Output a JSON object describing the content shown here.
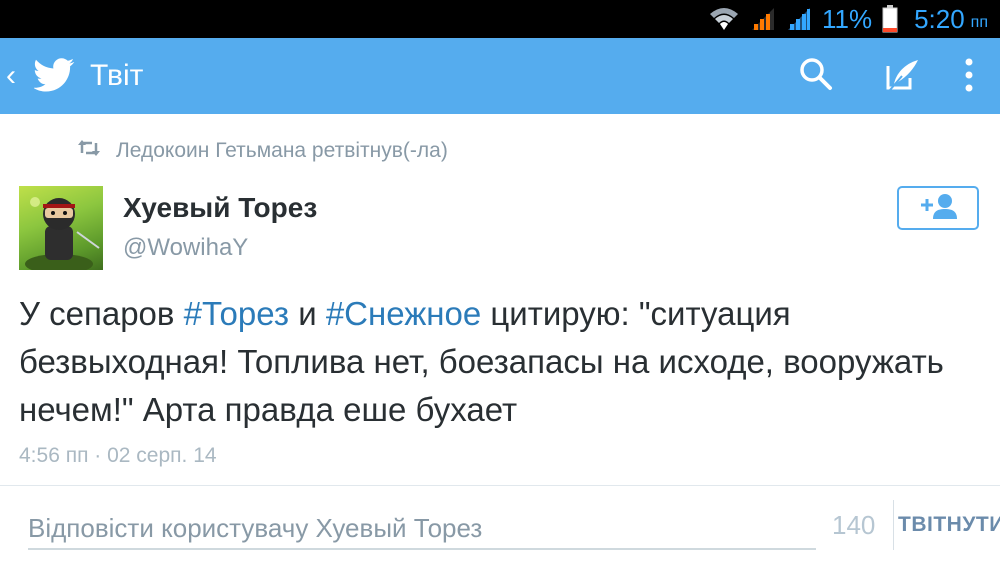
{
  "status_bar": {
    "battery_percent_label": "11%",
    "time": "5:20",
    "ampm": "пп",
    "battery_level": 0.11,
    "icons": [
      "wifi-icon",
      "signal-icon",
      "signal-icon",
      "battery-icon"
    ],
    "accent_color": "#33a7ff"
  },
  "action_bar": {
    "title": "Твіт",
    "background_color": "#55acee",
    "icons": [
      "back-chevron-icon",
      "twitter-bird-icon",
      "search-icon",
      "compose-tweet-icon",
      "overflow-menu-icon"
    ]
  },
  "tweet": {
    "retweet_notice": "Ледокоин Гетьмана ретвітнув(-ла)",
    "author_name": "Хуевый Торез",
    "author_handle": "@WowihaY",
    "text_part1": "У сепаров ",
    "hashtag1": "#Торез",
    "text_part2": " и ",
    "hashtag2": "#Снежное",
    "text_part3": " цитирую: \"ситуация безвыходная! Топлива нет, боезапасы на исходе, вооружать нечем!\" Арта правда еше бухает",
    "timestamp": "4:56 пп · 02 серп. 14",
    "hashtag_color": "#2b7bb9",
    "follow_icon": "add-user-icon"
  },
  "reply": {
    "placeholder": "Відповісти користувачу Хуевый Торез",
    "char_count": "140",
    "tweet_button_label": "ТВІТНУТИ"
  }
}
